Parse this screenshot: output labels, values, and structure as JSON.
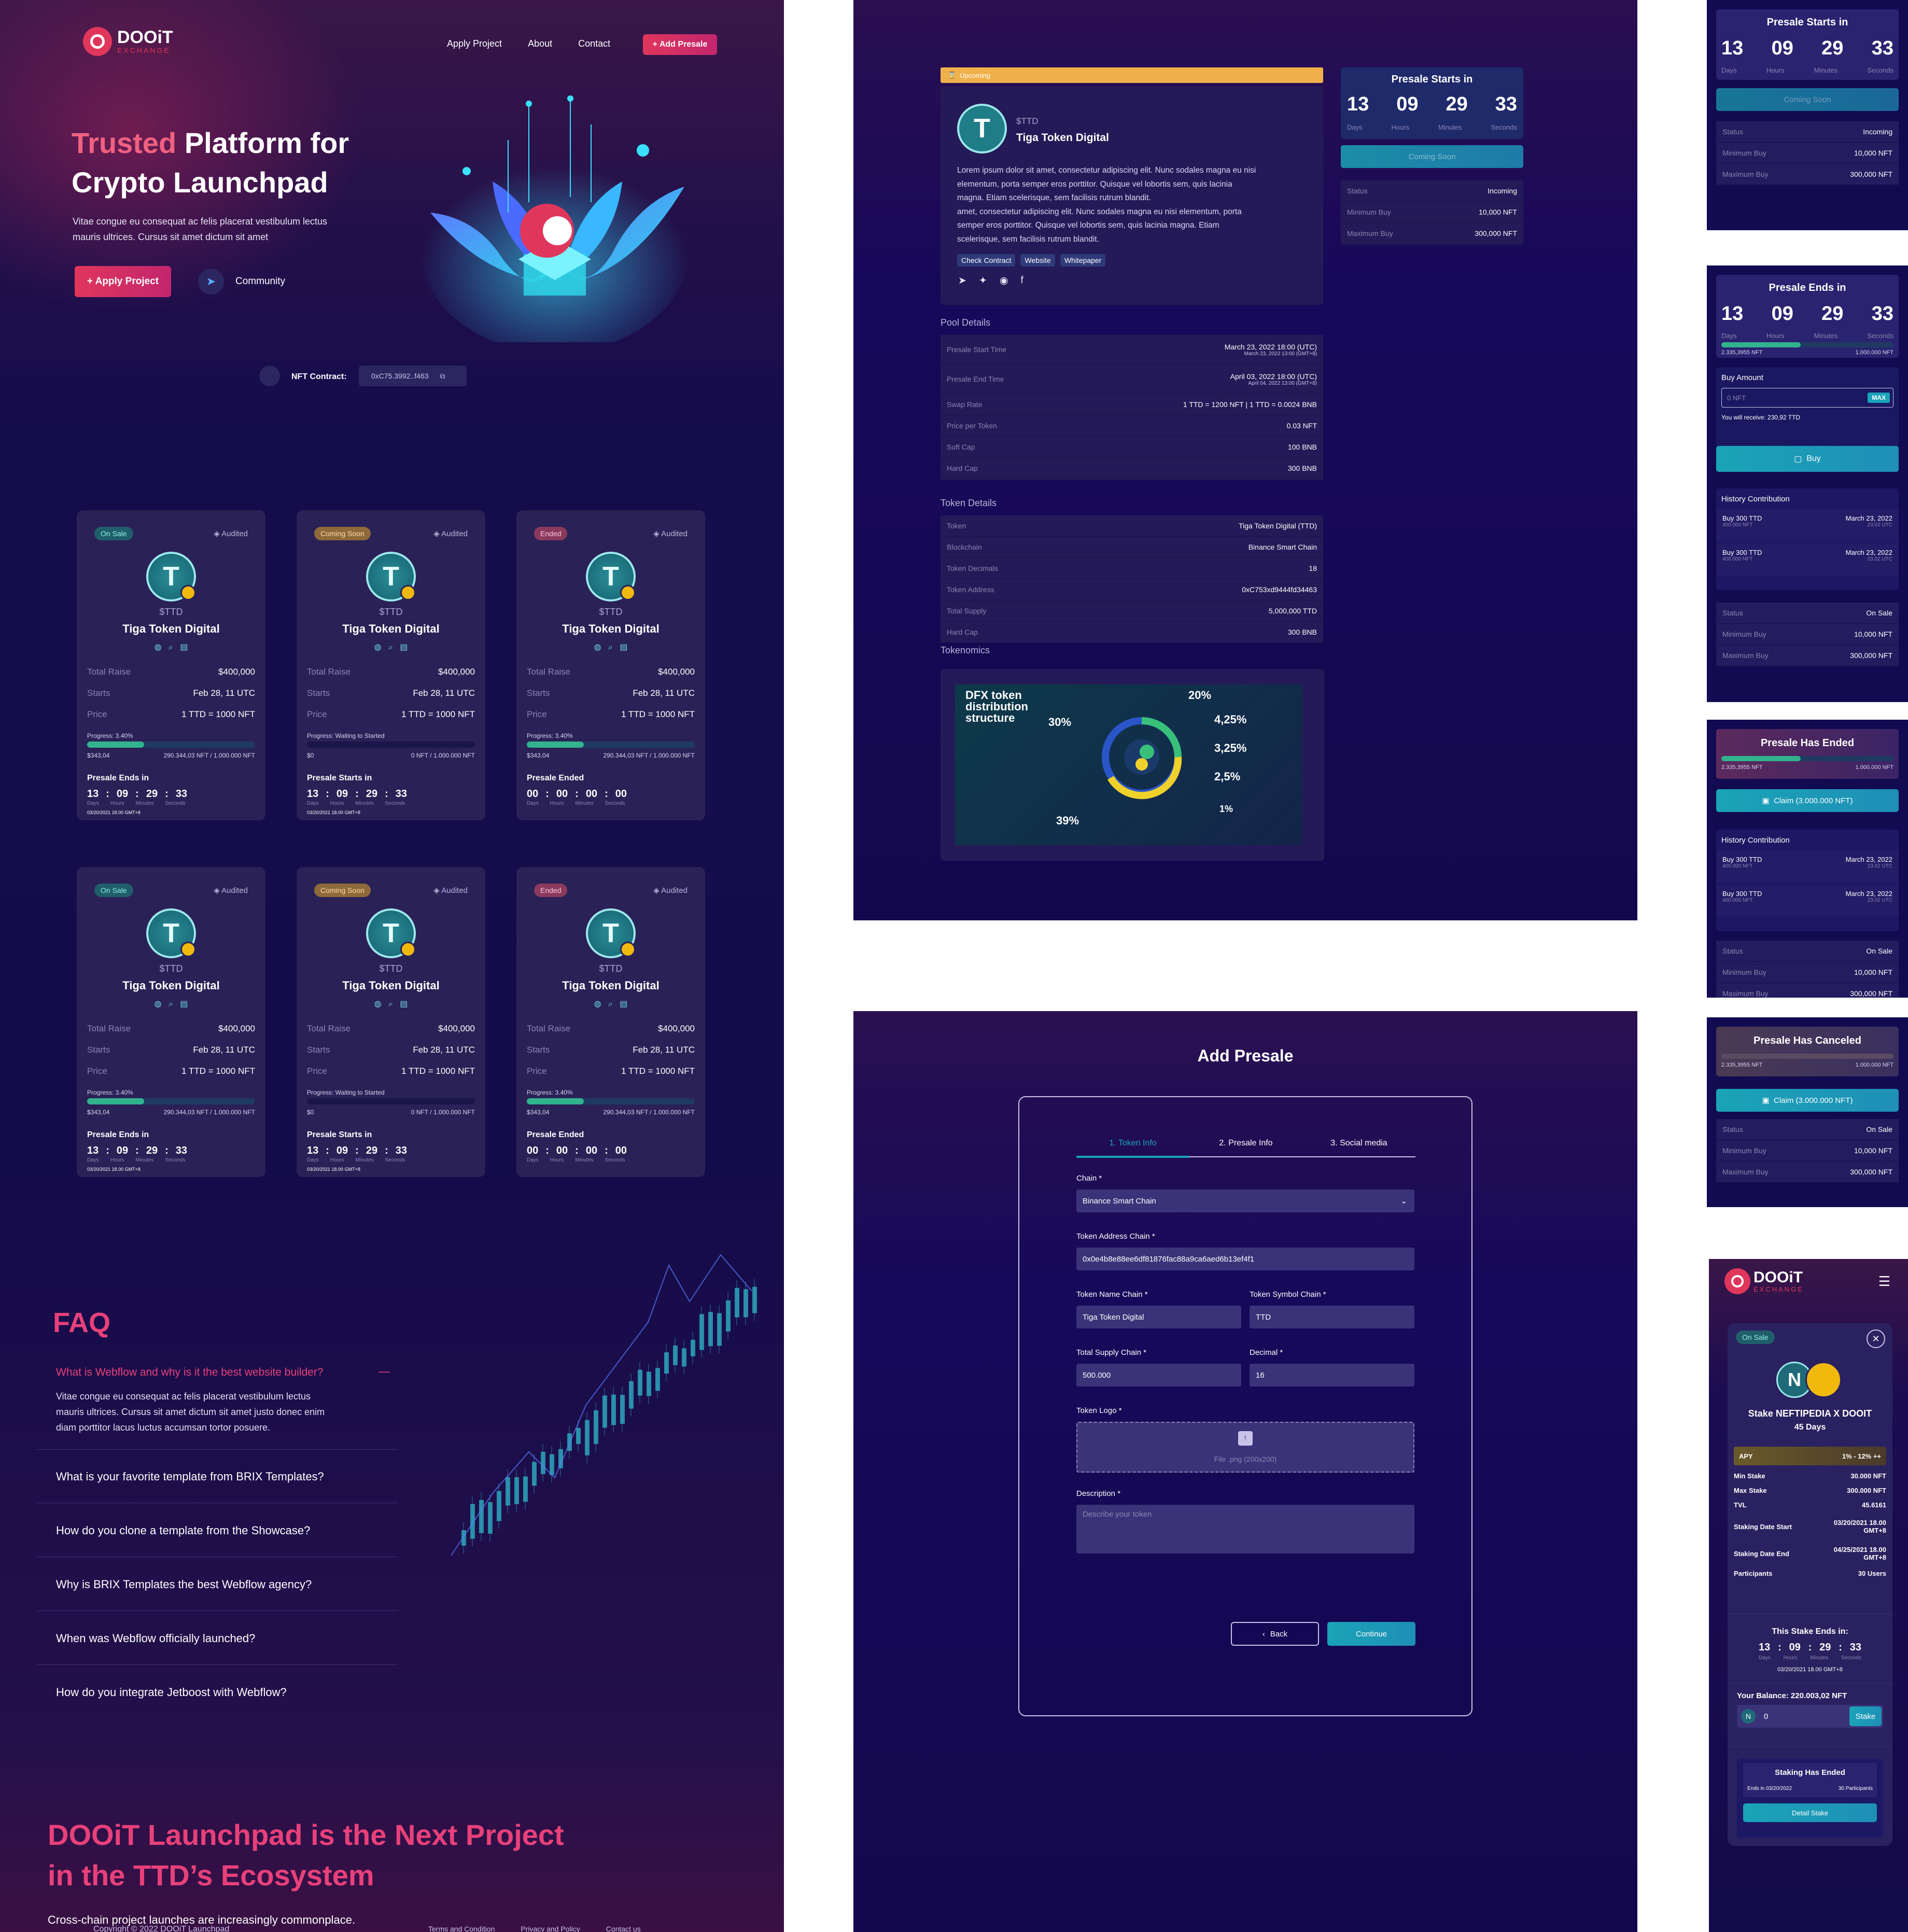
{
  "landing": {
    "logo": {
      "name": "DOOiT",
      "sub": "EXCHANGE"
    },
    "nav": [
      "Apply Project",
      "About",
      "Contact"
    ],
    "add_presale": "+ Add Presale",
    "hero": {
      "title_accent": "Trusted",
      "title_rest": " Platform for",
      "title_line2": "Crypto Launchpad",
      "desc_line1": "Vitae congue eu consequat ac felis placerat vestibulum lectus",
      "desc_line2": "mauris ultrices. Cursus sit amet dictum sit amet",
      "apply_btn": "+ Apply Project",
      "community": "Community"
    },
    "nft_contract": {
      "label": "NFT Contract:",
      "value": "0xC75.3992..f463"
    },
    "cards": [
      {
        "status": "On Sale",
        "audited": "Audited",
        "symbol": "$TTD",
        "name": "Tiga Token Digital",
        "total_raise_label": "Total Raise",
        "total_raise": "$400,000",
        "starts_label": "Starts",
        "starts": "Feb 28, 11 UTC",
        "price_label": "Price",
        "price": "1 TTD = 1000 NFT",
        "progress_label": "Progress: 3.40%",
        "progress": 0.34,
        "raised": "$343,04",
        "raised_nft": "290.344,03 NFT / 1.000.000 NFT",
        "timer_label": "Presale Ends in",
        "timer": [
          "13",
          "09",
          "29",
          "33"
        ],
        "timer_units": [
          "Days",
          "Hours",
          "Minutes",
          "Seconds"
        ],
        "date": "03/20/2021 18.00 GMT+8"
      },
      {
        "status": "Coming Soon",
        "audited": "Audited",
        "symbol": "$TTD",
        "name": "Tiga Token Digital",
        "total_raise_label": "Total Raise",
        "total_raise": "$400,000",
        "starts_label": "Starts",
        "starts": "Feb 28, 11 UTC",
        "price_label": "Price",
        "price": "1 TTD = 1000 NFT",
        "progress_label": "Progress: Waiting to Started",
        "progress": 0.0,
        "raised": "$0",
        "raised_nft": "0 NFT / 1.000.000 NFT",
        "timer_label": "Presale Starts in",
        "timer": [
          "13",
          "09",
          "29",
          "33"
        ],
        "timer_units": [
          "Days",
          "Hours",
          "Minutes",
          "Seconds"
        ],
        "date": "03/20/2021 18.00 GMT+8"
      },
      {
        "status": "Ended",
        "audited": "Audited",
        "symbol": "$TTD",
        "name": "Tiga Token Digital",
        "total_raise_label": "Total Raise",
        "total_raise": "$400,000",
        "starts_label": "Starts",
        "starts": "Feb 28, 11 UTC",
        "price_label": "Price",
        "price": "1 TTD = 1000 NFT",
        "progress_label": "Progress: 3.40%",
        "progress": 0.34,
        "raised": "$343,04",
        "raised_nft": "290.344,03 NFT / 1.000.000 NFT",
        "timer_label": "Presale Ended",
        "timer": [
          "00",
          "00",
          "00",
          "00"
        ],
        "timer_units": [
          "Days",
          "Hours",
          "Minutes",
          "Seconds"
        ],
        "date": ""
      },
      {
        "status": "On Sale",
        "audited": "Audited",
        "symbol": "$TTD",
        "name": "Tiga Token Digital",
        "total_raise_label": "Total Raise",
        "total_raise": "$400,000",
        "starts_label": "Starts",
        "starts": "Feb 28, 11 UTC",
        "price_label": "Price",
        "price": "1 TTD = 1000 NFT",
        "progress_label": "Progress: 3.40%",
        "progress": 0.34,
        "raised": "$343,04",
        "raised_nft": "290.344,03 NFT / 1.000.000 NFT",
        "timer_label": "Presale Ends in",
        "timer": [
          "13",
          "09",
          "29",
          "33"
        ],
        "timer_units": [
          "Days",
          "Hours",
          "Minutes",
          "Seconds"
        ],
        "date": "03/20/2021 18.00 GMT+8"
      },
      {
        "status": "Coming Soon",
        "audited": "Audited",
        "symbol": "$TTD",
        "name": "Tiga Token Digital",
        "total_raise_label": "Total Raise",
        "total_raise": "$400,000",
        "starts_label": "Starts",
        "starts": "Feb 28, 11 UTC",
        "price_label": "Price",
        "price": "1 TTD = 1000 NFT",
        "progress_label": "Progress: Waiting to Started",
        "progress": 0.0,
        "raised": "$0",
        "raised_nft": "0 NFT / 1.000.000 NFT",
        "timer_label": "Presale Starts in",
        "timer": [
          "13",
          "09",
          "29",
          "33"
        ],
        "timer_units": [
          "Days",
          "Hours",
          "Minutes",
          "Seconds"
        ],
        "date": "03/20/2021 18.00 GMT+8"
      },
      {
        "status": "Ended",
        "audited": "Audited",
        "symbol": "$TTD",
        "name": "Tiga Token Digital",
        "total_raise_label": "Total Raise",
        "total_raise": "$400,000",
        "starts_label": "Starts",
        "starts": "Feb 28, 11 UTC",
        "price_label": "Price",
        "price": "1 TTD = 1000 NFT",
        "progress_label": "Progress: 3.40%",
        "progress": 0.34,
        "raised": "$343,04",
        "raised_nft": "290.344,03 NFT / 1.000.000 NFT",
        "timer_label": "Presale Ended",
        "timer": [
          "00",
          "00",
          "00",
          "00"
        ],
        "timer_units": [
          "Days",
          "Hours",
          "Minutes",
          "Seconds"
        ],
        "date": ""
      }
    ],
    "faq": {
      "title": "FAQ",
      "open_q": "What is Webflow and why is it the best website builder?",
      "open_a1": "Vitae congue eu consequat ac felis placerat vestibulum lectus",
      "open_a2": "mauris ultrices. Cursus sit amet dictum sit amet justo donec enim",
      "open_a3": "diam porttitor lacus luctus accumsan tortor posuere.",
      "questions": [
        "What is your favorite template from BRIX Templates?",
        "How do you clone a template from the Showcase?",
        "Why is BRIX Templates the best Webflow agency?",
        "When was Webflow officially launched?",
        "How do you integrate Jetboost with Webflow?"
      ]
    },
    "cta": {
      "line1": "DOOiT Launchpad is the Next Project",
      "line2": "in the TTD’s Ecosystem",
      "sub": "Cross-chain project launches are increasingly commonplace.",
      "copyright": "Copyright © 2022 DOOiT Launchpad",
      "links": [
        "Terms and Condition",
        "Privacy and Policy",
        "Contact us"
      ]
    }
  },
  "detail": {
    "upcoming": "Upcoming",
    "symbol": "$TTD",
    "name": "Tiga Token Digital",
    "desc": [
      "Lorem ipsum dolor sit amet, consectetur adipiscing elit. Nunc sodales magna eu nisi",
      "elementum, porta semper eros porttitor. Quisque vel lobortis sem, quis lacinia",
      "magna. Etiam scelerisque, sem facilisis rutrum blandit.",
      " amet, consectetur adipiscing elit. Nunc sodales magna eu nisi elementum, porta",
      "semper eros porttitor. Quisque vel lobortis sem, quis lacinia magna. Etiam",
      "scelerisque, sem facilisis rutrum blandit."
    ],
    "links": [
      "Check Contract",
      "Website",
      "Whitepaper"
    ],
    "timer_title": "Presale Starts in",
    "timer": [
      "13",
      "09",
      "29",
      "33"
    ],
    "timer_units": [
      "Days",
      "Hours",
      "Minutes",
      "Seconds"
    ],
    "coming_soon": "Coming Soon",
    "status_rows": [
      [
        "Status",
        "Incoming"
      ],
      [
        "Minimum Buy",
        "10,000 NFT"
      ],
      [
        "Maximum Buy",
        "300,000 NFT"
      ]
    ],
    "pool_title": "Pool Details",
    "pool_rows": [
      [
        "Presale  Start Time",
        "March 23, 2022  18:00 (UTC)",
        "March 23, 2022  13:00 (GMT+8)"
      ],
      [
        "Presale  End Time",
        "April 03, 2022  18:00 (UTC)",
        "April 04, 2022  13:00 (GMT+8)"
      ],
      [
        "Swap Rate",
        "1 TTD = 1200 NFT | 1 TTD = 0.0024 BNB",
        ""
      ],
      [
        "Price per Token",
        "0.03 NFT",
        ""
      ],
      [
        "Soft Cap",
        "100 BNB",
        ""
      ],
      [
        "Hard Cap",
        "300 BNB",
        ""
      ]
    ],
    "token_title": "Token Details",
    "token_rows": [
      [
        "Token",
        "Tiga Token Digital (TTD)"
      ],
      [
        "Blockchain",
        "Binance Smart Chain"
      ],
      [
        "Token Decimals",
        "18"
      ],
      [
        "Token Address",
        "0xC753xd9444fd34463"
      ],
      [
        "Total Supply",
        "5,000,000 TTD"
      ],
      [
        "Hard Cap",
        "300 BNB"
      ]
    ],
    "tokenomics_title": "Tokenomics",
    "chart_title": [
      "DFX token",
      "distribution",
      "structure"
    ],
    "chart_labels": [
      "30%",
      "20%",
      "4,25%",
      "3,25%",
      "2,5%",
      "1%",
      "39%"
    ]
  },
  "addp": {
    "title": "Add Presale",
    "tabs": [
      "1. Token Info",
      "2. Presale Info",
      "3. Social media"
    ],
    "chain_label": "Chain *",
    "chain_value": "Binance Smart Chain",
    "addr_label": "Token Address Chain *",
    "addr_value": "0x0e4b8e88ee6df81876fac88a9ca6aed6b13ef4f1",
    "name_label": "Token Name Chain *",
    "name_value": "Tiga Token Digital",
    "symbol_label": "Token Symbol Chain *",
    "symbol_value": "TTD",
    "supply_label": "Total Supply Chain *",
    "supply_value": "500.000",
    "decimal_label": "Decimal *",
    "decimal_value": "16",
    "logo_label": "Token Logo *",
    "logo_hint": "File .png (200x200)",
    "desc_label": "Description *",
    "desc_placeholder": "Describe your token",
    "back": "Back",
    "continue": "Continue"
  },
  "widgets": {
    "w1": {
      "title": "Presale Starts in",
      "timer": [
        "13",
        "09",
        "29",
        "33"
      ],
      "units": [
        "Days",
        "Hours",
        "Minutes",
        "Seconds"
      ],
      "btn": "Coming Soon",
      "rows": [
        [
          "Status",
          "Incoming"
        ],
        [
          "Minimum Buy",
          "10,000 NFT"
        ],
        [
          "Maximum Buy",
          "300,000 NFT"
        ]
      ]
    },
    "w2": {
      "title": "Presale Ends in",
      "timer": [
        "13",
        "09",
        "29",
        "33"
      ],
      "units": [
        "Days",
        "Hours",
        "Minutes",
        "Seconds"
      ],
      "prog_left": "2.335,3955 NFT",
      "prog_right": "1.000.000 NFT",
      "progress": 0.46,
      "buy_label": "Buy Amount",
      "buy_placeholder": "0 NFT",
      "max": "MAX",
      "receive": "You will receive: 230,92 TTD",
      "buy": "Buy",
      "history_title": "History Contribution",
      "history": [
        [
          "Buy 300 TTD",
          "400.000 NFT",
          "March 23, 2022",
          "23.02 UTC"
        ],
        [
          "Buy 300 TTD",
          "400.000 NFT",
          "March 23, 2022",
          "23.02 UTC"
        ]
      ],
      "rows": [
        [
          "Status",
          "On Sale"
        ],
        [
          "Minimum Buy",
          "10,000 NFT"
        ],
        [
          "Maximum Buy",
          "300,000 NFT"
        ]
      ]
    },
    "w3": {
      "title": "Presale Has Ended",
      "prog_left": "2.335,3955 NFT",
      "prog_right": "1.000.000 NFT",
      "progress": 0.46,
      "claim": "Claim (3.000.000 NFT)",
      "history_title": "History Contribution",
      "history": [
        [
          "Buy 300 TTD",
          "400.000 NFT",
          "March 23, 2022",
          "23.02 UTC"
        ],
        [
          "Buy 300 TTD",
          "400.000 NFT",
          "March 23, 2022",
          "23.02 UTC"
        ]
      ],
      "rows": [
        [
          "Status",
          "On Sale"
        ],
        [
          "Minimum Buy",
          "10,000 NFT"
        ],
        [
          "Maximum Buy",
          "300,000 NFT"
        ]
      ]
    },
    "w4": {
      "title": "Presale Has Canceled",
      "prog_left": "2.335,3955 NFT",
      "prog_right": "1.000.000 NFT",
      "progress": 0.0,
      "claim": "Claim (3.000.000 NFT)",
      "rows": [
        [
          "Status",
          "On Sale"
        ],
        [
          "Minimum Buy",
          "10,000 NFT"
        ],
        [
          "Maximum Buy",
          "300,000 NFT"
        ]
      ]
    }
  },
  "mobile": {
    "logo": {
      "name": "DOOiT",
      "sub": "EXCHANGE"
    },
    "badge": "On Sale",
    "title": "Stake NEFTIPEDIA X DOOIT",
    "days": "45 Days",
    "apy_label": "APY",
    "apy_value": "1% - 12% ++",
    "rows": [
      [
        "Min Stake",
        "30.000 NFT"
      ],
      [
        "Max Stake",
        "300.000 NFT"
      ],
      [
        "TVL",
        "45.6161"
      ],
      [
        "Staking Date Start",
        "03/20/2021 18.00 GMT+8"
      ],
      [
        "Staking Date End",
        "04/25/2021 18.00 GMT+8"
      ],
      [
        "Participants",
        "30 Users"
      ]
    ],
    "ends_label": "This Stake Ends in:",
    "timer": [
      "13",
      "09",
      "29",
      "33"
    ],
    "units": [
      "Days",
      "Hours",
      "Minutes",
      "Seconds"
    ],
    "timer_date": "03/20/2021 18.00 GMT+8",
    "balance": "Your Balance: 220.003,02 NFT",
    "stake_input": "0",
    "stake_btn": "Stake",
    "ended_title": "Staking Has Ended",
    "ended_left": "Ends in 03/20/2022",
    "ended_right": "30 Participants",
    "detail_btn": "Detail Stake"
  },
  "colors": {
    "accent_pink": "#e0365c",
    "teal": "#1aa3b8",
    "bg_navy": "#140b4a",
    "card": "#2a2257"
  }
}
